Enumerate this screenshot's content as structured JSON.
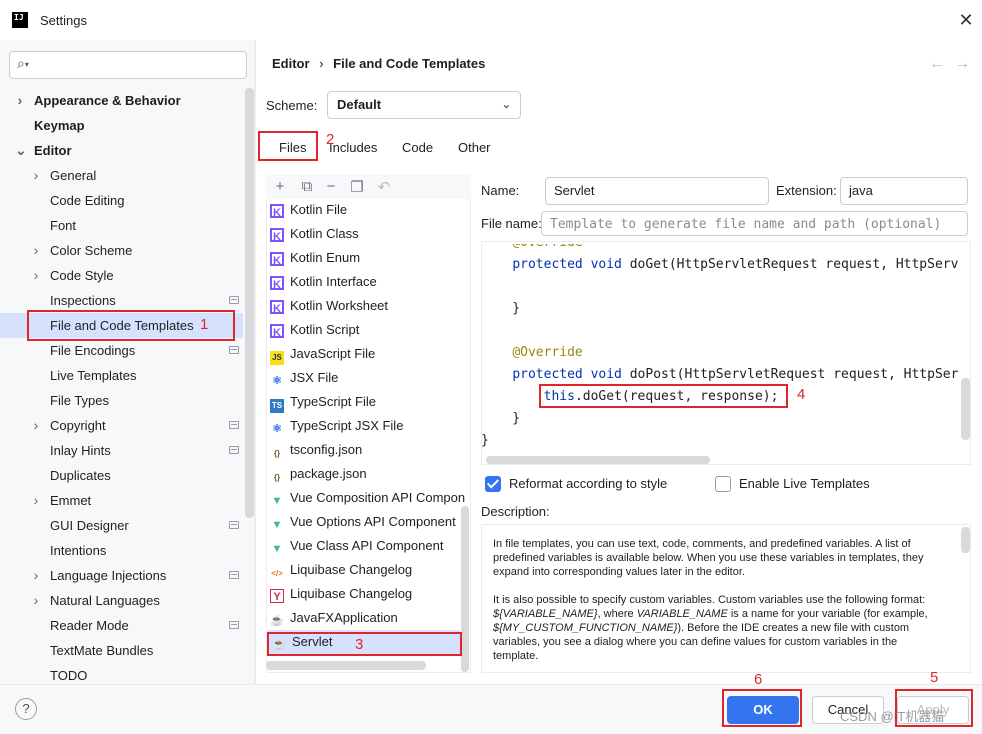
{
  "window": {
    "title": "Settings",
    "app_logo_text": "IJ",
    "close_icon": "close-icon"
  },
  "search": {
    "placeholder": "",
    "icon": "search-icon"
  },
  "sidebar": {
    "items": [
      {
        "label": "Appearance & Behavior",
        "bold": true,
        "arrow": "right"
      },
      {
        "label": "Keymap",
        "bold": true
      },
      {
        "label": "Editor",
        "bold": true,
        "arrow": "down"
      },
      {
        "label": "General",
        "arrow": "right"
      },
      {
        "label": "Code Editing"
      },
      {
        "label": "Font"
      },
      {
        "label": "Color Scheme",
        "arrow": "right"
      },
      {
        "label": "Code Style",
        "arrow": "right"
      },
      {
        "label": "Inspections",
        "badge": true
      },
      {
        "label": "File and Code Templates",
        "selected": true
      },
      {
        "label": "File Encodings",
        "badge": true
      },
      {
        "label": "Live Templates"
      },
      {
        "label": "File Types"
      },
      {
        "label": "Copyright",
        "arrow": "right",
        "badge": true
      },
      {
        "label": "Inlay Hints",
        "badge": true
      },
      {
        "label": "Duplicates"
      },
      {
        "label": "Emmet",
        "arrow": "right"
      },
      {
        "label": "GUI Designer",
        "badge": true
      },
      {
        "label": "Intentions"
      },
      {
        "label": "Language Injections",
        "arrow": "right",
        "badge": true
      },
      {
        "label": "Natural Languages",
        "arrow": "right"
      },
      {
        "label": "Reader Mode",
        "badge": true
      },
      {
        "label": "TextMate Bundles"
      },
      {
        "label": "TODO"
      }
    ]
  },
  "breadcrumb": {
    "parent": "Editor",
    "separator": "›",
    "current": "File and Code Templates",
    "back": "←",
    "forward": "→"
  },
  "scheme": {
    "label": "Scheme:",
    "value": "Default",
    "chevron": "⌄"
  },
  "tabs": [
    {
      "label": "Files",
      "active": true
    },
    {
      "label": "Includes"
    },
    {
      "label": "Code"
    },
    {
      "label": "Other"
    }
  ],
  "toolbar_icons": [
    "add-icon",
    "copy-icon",
    "remove-icon",
    "duplicate-icon",
    "reset-icon"
  ],
  "templates": [
    {
      "label": "Kotlin File",
      "icon": "kotlin-icon"
    },
    {
      "label": "Kotlin Class",
      "icon": "kotlin-icon"
    },
    {
      "label": "Kotlin Enum",
      "icon": "kotlin-icon"
    },
    {
      "label": "Kotlin Interface",
      "icon": "kotlin-icon"
    },
    {
      "label": "Kotlin Worksheet",
      "icon": "kotlin-icon"
    },
    {
      "label": "Kotlin Script",
      "icon": "kotlin-icon"
    },
    {
      "label": "JavaScript File",
      "icon": "javascript-icon"
    },
    {
      "label": "JSX File",
      "icon": "react-icon"
    },
    {
      "label": "TypeScript File",
      "icon": "typescript-icon"
    },
    {
      "label": "TypeScript JSX File",
      "icon": "react-icon"
    },
    {
      "label": "tsconfig.json",
      "icon": "json-icon"
    },
    {
      "label": "package.json",
      "icon": "json-icon"
    },
    {
      "label": "Vue Composition API Compon",
      "icon": "vue-icon"
    },
    {
      "label": "Vue Options API Component",
      "icon": "vue-icon"
    },
    {
      "label": "Vue Class API Component",
      "icon": "vue-icon"
    },
    {
      "label": "Liquibase Changelog",
      "icon": "xml-icon"
    },
    {
      "label": "Liquibase Changelog",
      "icon": "yaml-icon"
    },
    {
      "label": "JavaFXApplication",
      "icon": "java-icon"
    },
    {
      "label": "Servlet",
      "icon": "java-icon",
      "selected": true
    }
  ],
  "form": {
    "name_label": "Name:",
    "name_value": "Servlet",
    "extension_label": "Extension:",
    "extension_value": "java",
    "filename_label": "File name:",
    "filename_placeholder": "Template to generate file name and path (optional)"
  },
  "code": [
    {
      "text": "    @Override",
      "kind": "ann",
      "partial": true
    },
    {
      "text": "    protected void doGet(HttpServletRequest request, HttpServ",
      "kind": "method"
    },
    {
      "text": ""
    },
    {
      "text": "    }"
    },
    {
      "text": ""
    },
    {
      "text": "    @Override",
      "kind": "ann"
    },
    {
      "text": "    protected void doPost(HttpServletRequest request, HttpSer",
      "kind": "method"
    },
    {
      "text": "        this.doGet(request, response);",
      "kind": "this"
    },
    {
      "text": "    }"
    },
    {
      "text": "}"
    }
  ],
  "options": {
    "reformat_label": "Reformat according to style",
    "reformat_checked": true,
    "live_templates_label": "Enable Live Templates",
    "live_templates_checked": false
  },
  "description": {
    "label": "Description:",
    "p1": "In file templates, you can use text, code, comments, and predefined variables. A list of predefined variables is available below. When you use these variables in templates, they expand into corresponding values later in the editor.",
    "p2a": "It is also possible to specify custom variables. Custom variables use the following format: ",
    "p2b": "${VARIABLE_NAME}",
    "p2c": ", where ",
    "p2d": "VARIABLE_NAME",
    "p2e": " is a name for your variable (for example, ",
    "p2f": "${MY_CUSTOM_FUNCTION_NAME}",
    "p2g": "). Before the IDE creates a new file with custom variables, you see a dialog where you can define values for custom variables in the template."
  },
  "buttons": {
    "ok": "OK",
    "cancel": "Cancel",
    "apply": "Apply",
    "help": "?"
  },
  "annotations": [
    "1",
    "2",
    "3",
    "4",
    "5",
    "6"
  ],
  "watermark": "CSDN @IT机器猫",
  "colors": {
    "accent": "#3574f0",
    "annotation_red": "#e0262b",
    "keyword": "#0033b3",
    "annotation": "#9e880d",
    "selection": "#d5e1fd"
  }
}
